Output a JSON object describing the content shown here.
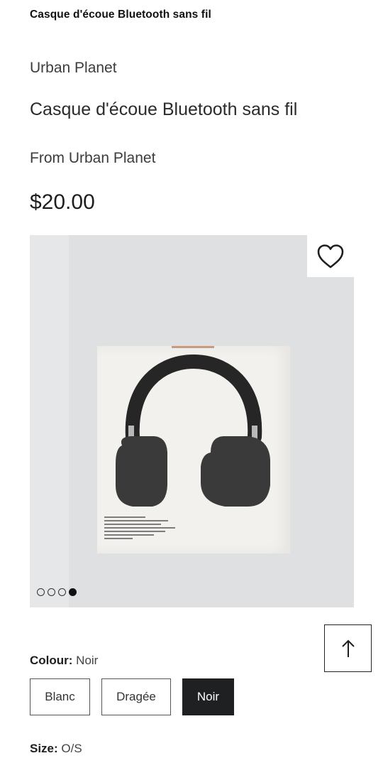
{
  "header": {
    "title": "Casque d'écoue Bluetooth sans fil"
  },
  "product": {
    "brand": "Urban Planet",
    "title": "Casque d'écoue Bluetooth sans fil",
    "from": "From Urban Planet",
    "price": "$20.00"
  },
  "gallery": {
    "image_count": 4,
    "active_index": 4,
    "favorite_icon": "heart-outline-icon"
  },
  "scroll_top_icon": "arrow-up-icon",
  "colour": {
    "label": "Colour:",
    "selected": "Noir",
    "options": [
      "Blanc",
      "Dragée",
      "Noir"
    ]
  },
  "size": {
    "label": "Size:",
    "selected": "O/S"
  }
}
